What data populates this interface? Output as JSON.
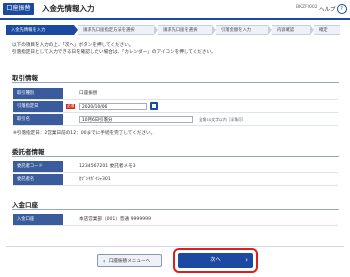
{
  "header": {
    "badge": "口座振替",
    "title": "入金先情報入力",
    "screen_id": "BKZFI002",
    "help_label": "ヘルプ",
    "help_icon_char": "?"
  },
  "steps": [
    {
      "label": "入金先情報を入力",
      "active": true
    },
    {
      "label": "請求先口座指定方法を選択",
      "active": false
    },
    {
      "label": "請求先口座を選択",
      "active": false
    },
    {
      "label": "引落金額を入力",
      "active": false
    },
    {
      "label": "内容確認",
      "active": false
    },
    {
      "label": "確定",
      "active": false
    }
  ],
  "instructions": {
    "line1": "以下の項目を入力の上、「次へ」ボタンを押してください。",
    "line2": "引落指定日として入力できる日を確認したい場合は、「カレンダー」のアイコンを押してください。"
  },
  "transfer_info": {
    "section_title": "取引情報",
    "type_label": "取引種別",
    "type_value": "口座振替",
    "date_label": "引落指定日",
    "required_badge": "必須",
    "date_value": "2020/10/06",
    "name_label": "取引名",
    "name_value": "10月6日引落分",
    "name_hint": "全角10文字以内［半角可］",
    "note": "※引落指定日：2営業日前の12：00までに手続を完了してください。"
  },
  "payee_info": {
    "section_title": "委託者情報",
    "code_label": "委託者コード",
    "code_value": "1234567201 委託者メモ3",
    "name_label": "委託者名",
    "name_value": "ｶﾌﾞｼｷｶﾞｲｼｬ301"
  },
  "deposit_account": {
    "section_title": "入金口座",
    "account_label": "入金口座",
    "account_value": "本店営業部（001）普通 9999999"
  },
  "footer": {
    "back_label": "口座振替メニューへ",
    "back_arrow": "‹",
    "next_label": "次へ",
    "next_arrow": "›"
  },
  "colors": {
    "brand": "#1b4aa0",
    "label_bg": "#3a5b9c",
    "required": "#d7261e",
    "highlight_ring": "#d72020"
  }
}
